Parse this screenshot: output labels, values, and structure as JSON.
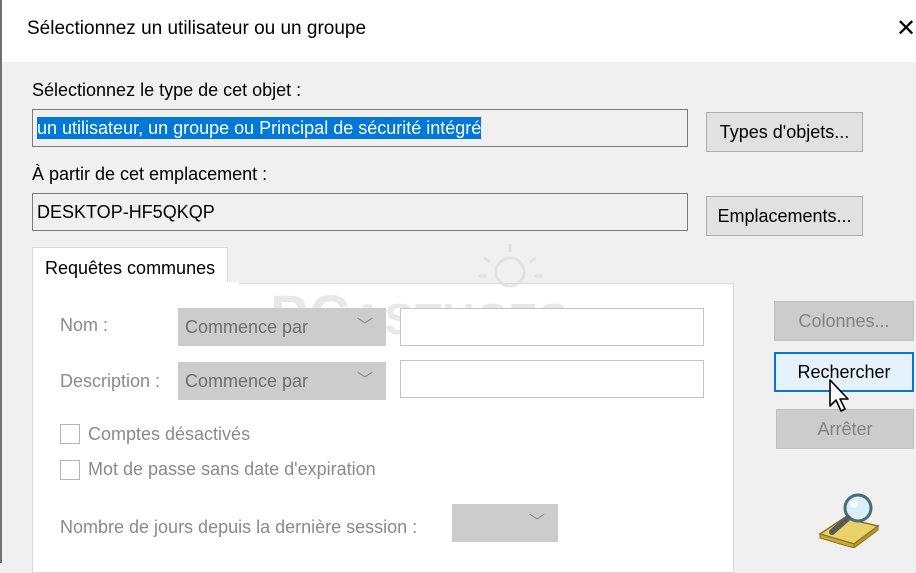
{
  "dialog": {
    "title": "Sélectionnez un utilisateur ou un groupe",
    "close_glyph": "✕"
  },
  "object_type": {
    "label": "Sélectionnez le type de cet objet :",
    "value": "un utilisateur, un groupe ou Principal de sécurité intégré",
    "button": "Types d'objets..."
  },
  "location": {
    "label": "À partir de cet emplacement :",
    "value": "DESKTOP-HF5QKQP",
    "button": "Emplacements..."
  },
  "tab": {
    "label": "Requêtes communes"
  },
  "query": {
    "name_label": "Nom :",
    "name_mode": "Commence par",
    "description_label": "Description :",
    "description_mode": "Commence par",
    "disabled_accounts": "Comptes désactivés",
    "no_expiry_password": "Mot de passe sans date d'expiration",
    "days_since_last_session": "Nombre de jours depuis la dernière session :"
  },
  "side_buttons": {
    "columns": "Colonnes...",
    "search": "Rechercher",
    "stop": "Arrêter"
  },
  "watermark": {
    "big": "PC",
    "rest": "ASTUCES"
  }
}
